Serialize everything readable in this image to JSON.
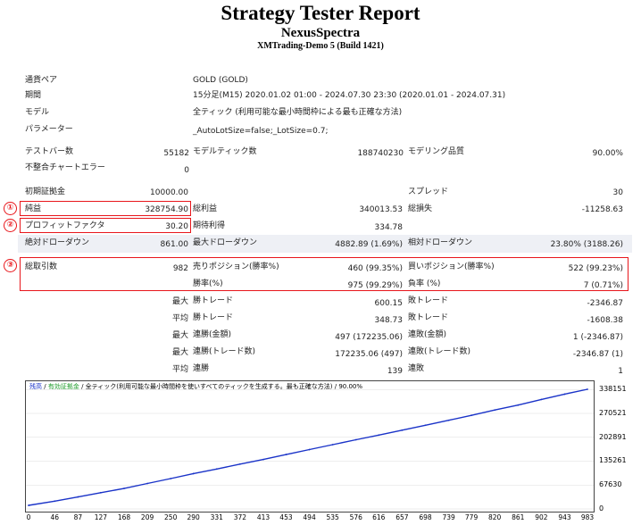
{
  "header": {
    "title": "Strategy Tester Report",
    "ea_name": "NexusSpectra",
    "server": "XMTrading-Demo 5 (Build 1421)"
  },
  "info": {
    "pair_label": "通貨ペア",
    "pair_value": "GOLD (GOLD)",
    "period_label": "期間",
    "period_value": "15分足(M15) 2020.01.02 01:00 - 2024.07.30 23:30 (2020.01.01 - 2024.07.31)",
    "model_label": "モデル",
    "model_value": "全ティック (利用可能な最小時間枠による最も正確な方法)",
    "params_label": "パラメーター",
    "params_value": "_AutoLotSize=false;_LotSize=0.7;"
  },
  "stats": {
    "bars_label": "テストバー数",
    "bars_value": "55182",
    "ticks_label": "モデルティック数",
    "ticks_value": "188740230",
    "quality_label": "モデリング品質",
    "quality_value": "90.00%",
    "mismatch_label": "不整合チャートエラー",
    "mismatch_value": "0",
    "deposit_label": "初期証拠金",
    "deposit_value": "10000.00",
    "spread_label": "スプレッド",
    "spread_value": "30",
    "net_label": "純益",
    "net_value": "328754.90",
    "gross_profit_label": "総利益",
    "gross_profit_value": "340013.53",
    "gross_loss_label": "総損失",
    "gross_loss_value": "-11258.63",
    "pf_label": "プロフィットファクタ",
    "pf_value": "30.20",
    "expected_label": "期待利得",
    "expected_value": "334.78",
    "abs_dd_label": "絶対ドローダウン",
    "abs_dd_value": "861.00",
    "max_dd_label": "最大ドローダウン",
    "max_dd_value": "4882.89 (1.69%)",
    "rel_dd_label": "相対ドローダウン",
    "rel_dd_value": "23.80% (3188.26)",
    "trades_label": "総取引数",
    "trades_value": "982",
    "short_label": "売りポジション(勝率%)",
    "short_value": "460 (99.35%)",
    "long_label": "買いポジション(勝率%)",
    "long_value": "522 (99.23%)",
    "winrate_label": "勝率(%)",
    "winrate_value": "975 (99.29%)",
    "lossrate_label": "負率 (%)",
    "lossrate_value": "7 (0.71%)",
    "max_label": "最大",
    "avg_label": "平均",
    "largest_win_label": "勝トレード",
    "largest_win_value": "600.15",
    "largest_loss_label": "敗トレード",
    "largest_loss_value": "-2346.87",
    "avg_win_label": "勝トレード",
    "avg_win_value": "348.73",
    "avg_loss_label": "敗トレード",
    "avg_loss_value": "-1608.38",
    "consec_win_money_label": "連勝(金額)",
    "consec_win_money_value": "497 (172235.06)",
    "consec_loss_money_label": "連敗(金額)",
    "consec_loss_money_value": "1 (-2346.87)",
    "consec_win_count_label": "連勝(トレード数)",
    "consec_win_count_value": "172235.06 (497)",
    "consec_loss_count_label": "連敗(トレード数)",
    "consec_loss_count_value": "-2346.87 (1)",
    "avg_consec_win_label": "連勝",
    "avg_consec_win_value": "139",
    "avg_consec_loss_label": "連敗",
    "avg_consec_loss_value": "1"
  },
  "markers": {
    "m1": "①",
    "m2": "②",
    "m3": "③"
  },
  "colors": {
    "highlight": "#e8161b",
    "balance": "#1a33c8",
    "band": "#eef0f5"
  },
  "chart_data": {
    "type": "line",
    "legend": {
      "balance": "残高",
      "equity": "有効証拠金",
      "info": "全ティック(利用可能な最小時間枠を使いすべてのティックを生成する。最も正確な方法) / 90.00%"
    },
    "x_ticks": [
      "0",
      "46",
      "87",
      "127",
      "168",
      "209",
      "250",
      "290",
      "331",
      "372",
      "413",
      "453",
      "494",
      "535",
      "576",
      "616",
      "657",
      "698",
      "739",
      "779",
      "820",
      "861",
      "902",
      "943",
      "983"
    ],
    "y_ticks": [
      "338151",
      "270521",
      "202891",
      "135261",
      "67630",
      "0"
    ],
    "xlim": [
      0,
      983
    ],
    "ylim": [
      0,
      338764.9
    ],
    "series": [
      {
        "name": "残高",
        "x": [
          0,
          46,
          87,
          127,
          168,
          209,
          250,
          290,
          331,
          372,
          413,
          453,
          494,
          535,
          576,
          616,
          657,
          698,
          739,
          779,
          820,
          861,
          902,
          943,
          983
        ],
        "y": [
          10000,
          22000,
          34000,
          46000,
          58000,
          72000,
          86000,
          100000,
          113000,
          127000,
          140000,
          154000,
          168000,
          182000,
          196000,
          209000,
          223000,
          237000,
          251000,
          265000,
          280000,
          294000,
          310000,
          325000,
          338754.9
        ]
      }
    ]
  }
}
